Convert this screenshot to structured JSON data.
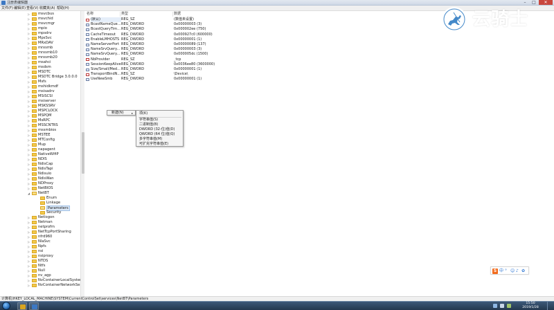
{
  "window": {
    "title": "注册表编辑器"
  },
  "menubar": [
    "文件(F)",
    "编辑(E)",
    "查看(V)",
    "收藏夹(A)",
    "帮助(H)"
  ],
  "tree": {
    "nodes": [
      {
        "label": "msvcbus",
        "expanded": false,
        "selected": false
      },
      {
        "label": "msvchid",
        "expanded": false,
        "selected": false
      },
      {
        "label": "msvcmgr",
        "expanded": false,
        "selected": false
      },
      {
        "label": "mpio",
        "expanded": false,
        "selected": false
      },
      {
        "label": "mpsdrv",
        "expanded": false,
        "selected": false
      },
      {
        "label": "MpsSvc",
        "expanded": false,
        "selected": false
      },
      {
        "label": "MRxDAV",
        "expanded": false,
        "selected": false
      },
      {
        "label": "mrxsmb",
        "expanded": false,
        "selected": false
      },
      {
        "label": "mrxsmb10",
        "expanded": false,
        "selected": false
      },
      {
        "label": "mrxsmb20",
        "expanded": false,
        "selected": false
      },
      {
        "label": "msahci",
        "expanded": false,
        "selected": false
      },
      {
        "label": "msdsm",
        "expanded": false,
        "selected": false
      },
      {
        "label": "MSDTC",
        "expanded": false,
        "selected": false
      },
      {
        "label": "MSDTC Bridge 3.0.0.0",
        "expanded": false,
        "selected": false
      },
      {
        "label": "Msfs",
        "expanded": false,
        "selected": false
      },
      {
        "label": "mshidkmdf",
        "expanded": false,
        "selected": false
      },
      {
        "label": "msisadrv",
        "expanded": false,
        "selected": false
      },
      {
        "label": "MSiSCSI",
        "expanded": false,
        "selected": false
      },
      {
        "label": "msiserver",
        "expanded": false,
        "selected": false
      },
      {
        "label": "MSKSSRV",
        "expanded": false,
        "selected": false
      },
      {
        "label": "MSPCLOCK",
        "expanded": false,
        "selected": false
      },
      {
        "label": "MSPQM",
        "expanded": false,
        "selected": false
      },
      {
        "label": "MsRPC",
        "expanded": false,
        "selected": false
      },
      {
        "label": "MSSCNTRS",
        "expanded": false,
        "selected": false
      },
      {
        "label": "mssmbios",
        "expanded": false,
        "selected": false
      },
      {
        "label": "MSTEE",
        "expanded": false,
        "selected": false
      },
      {
        "label": "MTConfig",
        "expanded": false,
        "selected": false
      },
      {
        "label": "Mup",
        "expanded": false,
        "selected": false
      },
      {
        "label": "napagent",
        "expanded": false,
        "selected": false
      },
      {
        "label": "NativeWifiP",
        "expanded": false,
        "selected": false
      },
      {
        "label": "NDIS",
        "expanded": false,
        "selected": false
      },
      {
        "label": "NdisCap",
        "expanded": false,
        "selected": false
      },
      {
        "label": "NdisTapi",
        "expanded": false,
        "selected": false
      },
      {
        "label": "Ndisuio",
        "expanded": false,
        "selected": false
      },
      {
        "label": "NdisWan",
        "expanded": false,
        "selected": false
      },
      {
        "label": "NDProxy",
        "expanded": false,
        "selected": false
      },
      {
        "label": "NetBIOS",
        "expanded": false,
        "selected": false
      },
      {
        "label": "NetBT",
        "expanded": true,
        "selected": false
      },
      {
        "label": "Enum",
        "expanded": false,
        "selected": false,
        "child": true
      },
      {
        "label": "Linkage",
        "expanded": false,
        "selected": false,
        "child": true
      },
      {
        "label": "Parameters",
        "expanded": false,
        "selected": true,
        "child": true
      },
      {
        "label": "Security",
        "expanded": false,
        "selected": false,
        "child": true
      },
      {
        "label": "Netlogon",
        "expanded": false,
        "selected": false
      },
      {
        "label": "Netman",
        "expanded": false,
        "selected": false
      },
      {
        "label": "netprofm",
        "expanded": false,
        "selected": false
      },
      {
        "label": "NetTcpPortSharing",
        "expanded": false,
        "selected": false
      },
      {
        "label": "nfrd960",
        "expanded": false,
        "selected": false
      },
      {
        "label": "NlaSvc",
        "expanded": false,
        "selected": false
      },
      {
        "label": "Npfs",
        "expanded": false,
        "selected": false
      },
      {
        "label": "nsi",
        "expanded": false,
        "selected": false
      },
      {
        "label": "nsiproxy",
        "expanded": false,
        "selected": false
      },
      {
        "label": "NTDS",
        "expanded": false,
        "selected": false
      },
      {
        "label": "Ntfs",
        "expanded": false,
        "selected": false
      },
      {
        "label": "Null",
        "expanded": false,
        "selected": false
      },
      {
        "label": "nv_agp",
        "expanded": false,
        "selected": false
      },
      {
        "label": "NvContainerLocalSystem",
        "expanded": false,
        "selected": false
      },
      {
        "label": "NvContainerNetworkServi",
        "expanded": false,
        "selected": false
      }
    ]
  },
  "values": {
    "columns": [
      "名称",
      "类型",
      "数据"
    ],
    "rows": [
      {
        "name": "(默认)",
        "type": "REG_SZ",
        "data": "(数值未设置)",
        "kind": "sz"
      },
      {
        "name": "BcastNameQue...",
        "type": "REG_DWORD",
        "data": "0x00000003 (3)",
        "kind": "dw"
      },
      {
        "name": "BcastQueryTim...",
        "type": "REG_DWORD",
        "data": "0x000002ee (750)",
        "kind": "dw"
      },
      {
        "name": "CacheTimeout",
        "type": "REG_DWORD",
        "data": "0x000927c0 (600000)",
        "kind": "dw"
      },
      {
        "name": "EnableLMHOSTS",
        "type": "REG_DWORD",
        "data": "0x00000001 (1)",
        "kind": "dw"
      },
      {
        "name": "NameServerPort",
        "type": "REG_DWORD",
        "data": "0x00000089 (137)",
        "kind": "dw"
      },
      {
        "name": "NameSrvQuery...",
        "type": "REG_DWORD",
        "data": "0x00000003 (3)",
        "kind": "dw"
      },
      {
        "name": "NameSrvQuery...",
        "type": "REG_DWORD",
        "data": "0x000005dc (1500)",
        "kind": "dw"
      },
      {
        "name": "NbProvider",
        "type": "REG_SZ",
        "data": "_tcp",
        "kind": "sz"
      },
      {
        "name": "SessionKeepAlive",
        "type": "REG_DWORD",
        "data": "0x0036ee80 (3600000)",
        "kind": "dw"
      },
      {
        "name": "Size/Small/Med...",
        "type": "REG_DWORD",
        "data": "0x00000001 (1)",
        "kind": "dw"
      },
      {
        "name": "TransportBindN...",
        "type": "REG_SZ",
        "data": "\\Device\\",
        "kind": "sz"
      },
      {
        "name": "UseNewSmb",
        "type": "REG_DWORD",
        "data": "0x00000001 (1)",
        "kind": "dw"
      }
    ]
  },
  "context_menu": {
    "new_label": "新建(N)",
    "arrow": "▸",
    "submenu": [
      "项(K)",
      "字符串值(S)",
      "二进制值(B)",
      "DWORD (32-位)值(D)",
      "QWORD (64 位)值(Q)",
      "多字符串值(M)",
      "可扩充字符串值(E)"
    ]
  },
  "statusbar": {
    "path": "计算机\\HKEY_LOCAL_MACHINE\\SYSTEM\\CurrentControlSet\\services\\NetBT\\Parameters"
  },
  "taskbar": {
    "time": "15:50",
    "date": "2019/1/28"
  },
  "watermark": {
    "text": "云骑士"
  },
  "colors": {
    "folder": "#f2c94c",
    "taskbar": "#2c4462",
    "selection": "#dbe8f7",
    "ime_accent": "#f26b1d"
  }
}
